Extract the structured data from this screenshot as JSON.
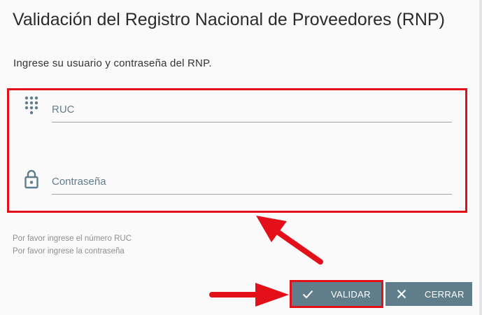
{
  "dialog": {
    "title": "Validación del Registro Nacional de Proveedores (RNP)",
    "subtitle": "Ingrese su usuario y contraseña del RNP."
  },
  "form": {
    "ruc": {
      "placeholder": "RUC",
      "icon": "dialpad-icon"
    },
    "password": {
      "placeholder": "Contraseña",
      "icon": "lock-icon"
    }
  },
  "validation": {
    "ruc_message": "Por favor ingrese el número RUC",
    "password_message": "Por favor ingrese la contraseña"
  },
  "actions": {
    "validate_label": "VALIDAR",
    "validate_icon": "check-icon",
    "close_label": "CERRAR",
    "close_icon": "close-icon"
  },
  "colors": {
    "highlight": "#e3101a",
    "button": "#607d8b",
    "icon": "#607d8b"
  }
}
